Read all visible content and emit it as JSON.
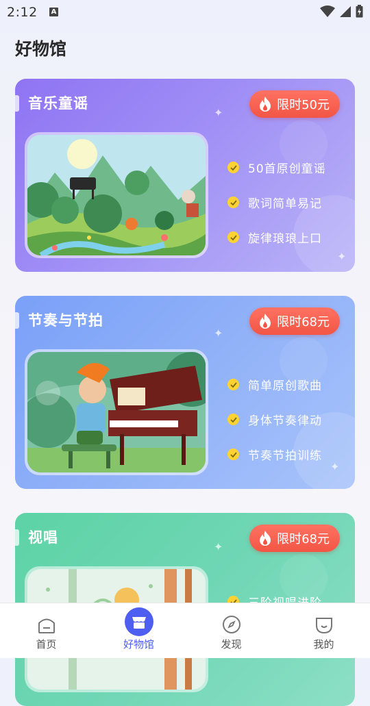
{
  "status_bar": {
    "time": "2:12"
  },
  "page": {
    "title": "好物馆"
  },
  "cards": [
    {
      "title": "音乐童谣",
      "price": "限时50元",
      "features": [
        "50首原创童谣",
        "歌词简单易记",
        "旋律琅琅上口"
      ]
    },
    {
      "title": "节奏与节拍",
      "price": "限时68元",
      "features": [
        "简单原创歌曲",
        "身体节奏律动",
        "节奏节拍训练"
      ]
    },
    {
      "title": "视唱",
      "price": "限时68元",
      "features": [
        "三阶视唱进阶"
      ]
    }
  ],
  "bottom_nav": {
    "items": [
      {
        "label": "首页",
        "icon": "home-icon"
      },
      {
        "label": "好物馆",
        "icon": "shop-icon"
      },
      {
        "label": "发现",
        "icon": "compass-icon"
      },
      {
        "label": "我的",
        "icon": "profile-icon"
      }
    ],
    "active_index": 1
  },
  "colors": {
    "accent": "#4e5ef0",
    "price_tag": "#f25545",
    "check": "#ffd233"
  }
}
